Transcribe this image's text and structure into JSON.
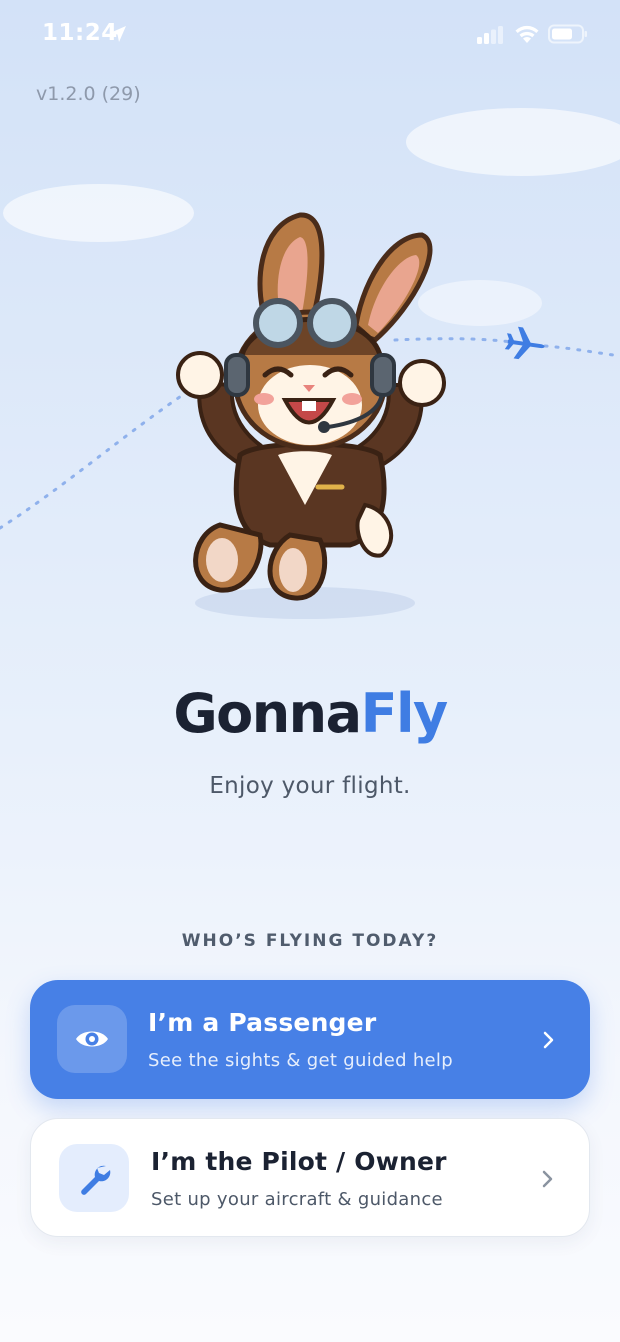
{
  "status_bar": {
    "time": "11:24"
  },
  "app": {
    "version": "v1.2.0 (29)"
  },
  "brand": {
    "part1": "Gonna",
    "part2": "Fly"
  },
  "tagline": "Enjoy your flight.",
  "section_label": "WHO’S FLYING TODAY?",
  "roles": [
    {
      "title": "I’m a Passenger",
      "subtitle": "See the sights & get guided help",
      "icon": "eye-icon"
    },
    {
      "title": "I’m the Pilot / Owner",
      "subtitle": "Set up your aircraft & guidance",
      "icon": "wrench-icon"
    }
  ],
  "colors": {
    "accent": "#4780e6",
    "brand_fly": "#3f7de3",
    "text_dark": "#1b2232"
  }
}
